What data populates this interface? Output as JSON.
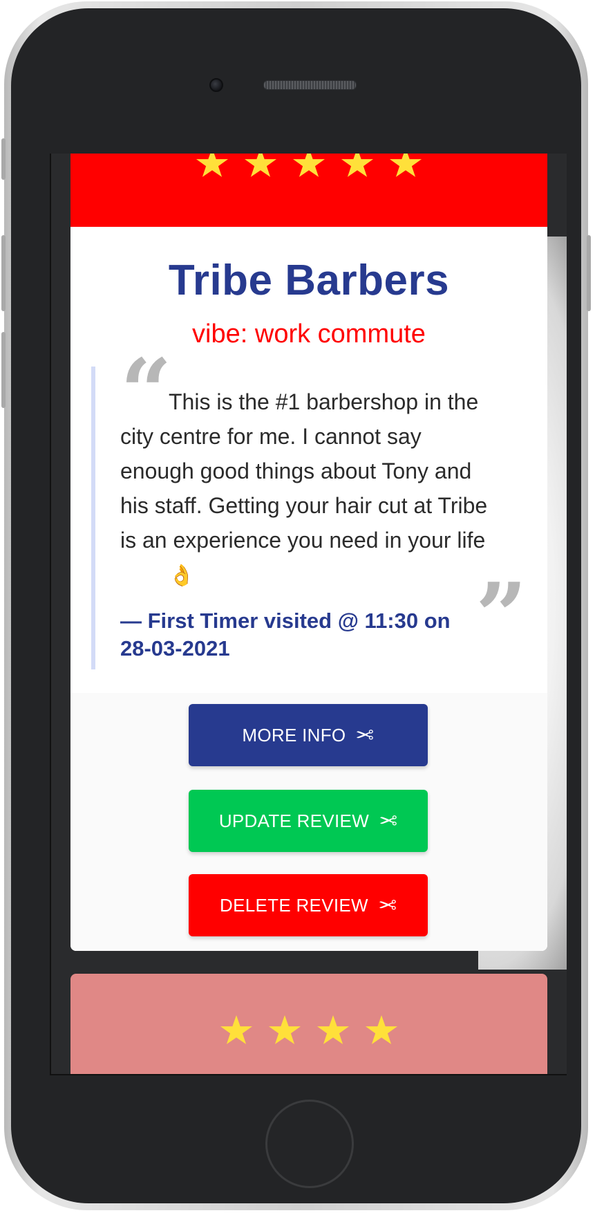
{
  "review": {
    "star_count": 5,
    "header_color": "#ff0000",
    "shop_name": "Tribe Barbers",
    "vibe": "vibe: work commute",
    "quote_open_mark": "“",
    "quote_close_mark": "”",
    "quote_text": "This is the #1 barbershop in the city centre for me. I cannot say enough good things about Tony and his staff. Getting your hair cut at Tribe is an experience you need in your life",
    "quote_emoji": "👌",
    "author": "— First Timer visited @ 11:30 on 28-03-2021"
  },
  "actions": {
    "more_info_label": "MORE INFO",
    "update_label": "UPDATE REVIEW",
    "delete_label": "DELETE REVIEW",
    "button_icon": "✂",
    "more_info_color": "#273a8f",
    "update_color": "#00c853",
    "delete_color": "#ff0000"
  },
  "next_review": {
    "star_count": 4,
    "header_color": "#e08886"
  },
  "icons": {
    "star": "star-icon",
    "scissors": "scissors-icon"
  }
}
